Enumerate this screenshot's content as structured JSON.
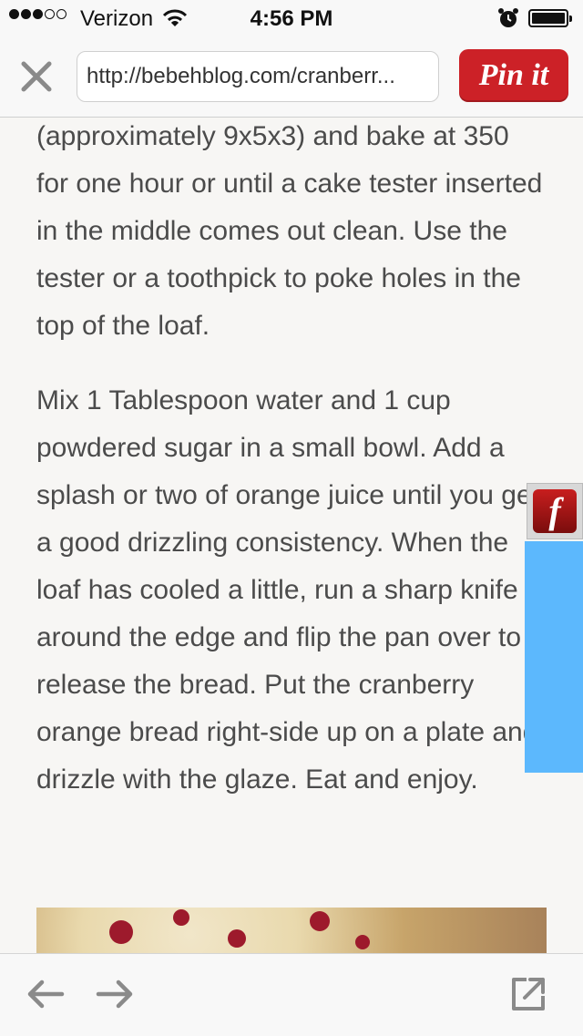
{
  "status_bar": {
    "carrier": "Verizon",
    "time": "4:56 PM",
    "signal_bars_filled": 3,
    "signal_bars_total": 5,
    "icons": [
      "wifi-icon",
      "alarm-clock-icon",
      "battery-icon"
    ]
  },
  "toolbar": {
    "url": "http://bebehblog.com/cranberr...",
    "pin_label": "Pin it",
    "brand_color": "#cc2127",
    "icons": [
      "close-icon"
    ]
  },
  "article": {
    "paragraphs": [
      "(approximately 9x5x3) and bake at 350 for one hour or until a cake tester inserted in the middle comes out clean. Use the tester or a toothpick to poke holes in the top of the loaf.",
      "Mix 1 Tablespoon water and 1 cup powdered sugar in a small bowl. Add a splash or two of orange juice until you get a good drizzling consistency. When the loaf has cooled a little, run a sharp knife around the edge and flip the pan over to release the bread. Put the cranberry orange bread right-side up on a plate and drizzle with the glaze. Eat and enjoy."
    ]
  },
  "overlay": {
    "flash_glyph": "f",
    "panel_color": "#5cb8fd"
  },
  "bottom_bar": {
    "icons": [
      "back-arrow-icon",
      "forward-arrow-icon",
      "open-external-icon"
    ]
  }
}
